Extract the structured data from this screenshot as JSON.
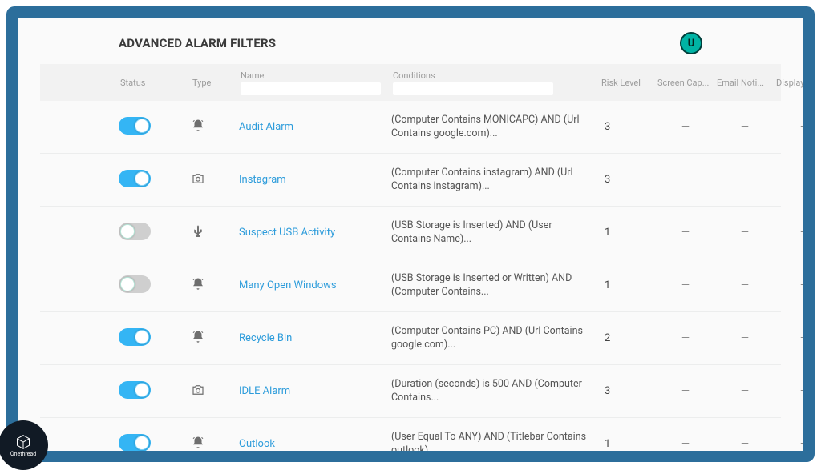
{
  "title": "ADVANCED ALARM FILTERS",
  "avatar": "U",
  "columns": {
    "status": "Status",
    "type": "Type",
    "name": "Name",
    "conditions": "Conditions",
    "risk": "Risk Level",
    "screen": "Screen Cap...",
    "email": "Email Noti...",
    "display": "Display Pop..."
  },
  "rows": [
    {
      "on": true,
      "icon": "bell",
      "name": "Audit Alarm",
      "conditions": "(Computer Contains MONICAPC) AND (Url Contains google.com)...",
      "risk": "3",
      "screen": "—",
      "email": "—",
      "display": "—"
    },
    {
      "on": true,
      "icon": "camera",
      "name": "Instagram",
      "conditions": "(Computer Contains instagram) AND (Url Contains instagram)...",
      "risk": "3",
      "screen": "—",
      "email": "—",
      "display": "—"
    },
    {
      "on": false,
      "icon": "usb",
      "name": "Suspect USB Activity",
      "conditions": "(USB Storage is Inserted) AND (User Contains Name)...",
      "risk": "1",
      "screen": "—",
      "email": "—",
      "display": "—"
    },
    {
      "on": false,
      "icon": "bell",
      "name": "Many Open Windows",
      "conditions": "(USB Storage is Inserted or Written) AND (Computer Contains...",
      "risk": "1",
      "screen": "—",
      "email": "—",
      "display": "—"
    },
    {
      "on": true,
      "icon": "bell",
      "name": "Recycle Bin",
      "conditions": "(Computer Contains PC) AND (Url Contains google.com)...",
      "risk": "2",
      "screen": "—",
      "email": "—",
      "display": "—"
    },
    {
      "on": true,
      "icon": "camera",
      "name": "IDLE Alarm",
      "conditions": "(Duration (seconds) is 500 AND (Computer Contains...",
      "risk": "3",
      "screen": "—",
      "email": "—",
      "display": "—"
    },
    {
      "on": true,
      "icon": "bell",
      "name": "Outlook",
      "conditions": "(User Equal To ANY) AND (Titlebar Contains outlook)...",
      "risk": "1",
      "screen": "—",
      "email": "—",
      "display": "—"
    }
  ],
  "logo_text": "Onethread"
}
